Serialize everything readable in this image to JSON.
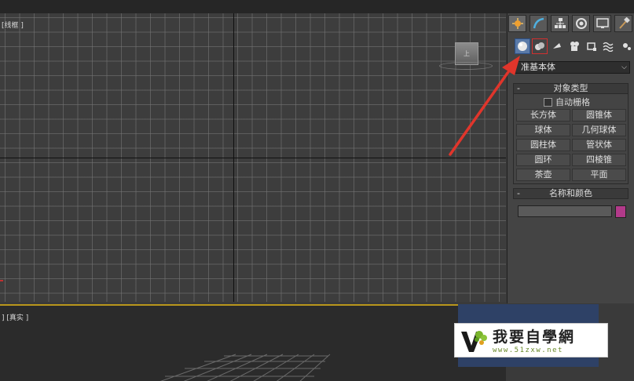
{
  "viewports": {
    "top": {
      "label": "[线框 ]",
      "viewcube_label": "上"
    },
    "perspective": {
      "label": "] [真实 ]"
    }
  },
  "command_panel": {
    "tabs": [
      {
        "name": "create",
        "icon": "star-icon"
      },
      {
        "name": "modify",
        "icon": "curve-icon"
      },
      {
        "name": "hierarchy",
        "icon": "hierarchy-icon"
      },
      {
        "name": "motion",
        "icon": "motion-icon"
      },
      {
        "name": "display",
        "icon": "monitor-icon"
      },
      {
        "name": "utilities",
        "icon": "hammer-icon"
      }
    ],
    "subtabs": [
      {
        "name": "geometry",
        "icon": "sphere-icon"
      },
      {
        "name": "shapes",
        "icon": "shapes-icon"
      },
      {
        "name": "lights",
        "icon": "light-icon"
      },
      {
        "name": "cameras",
        "icon": "camera-icon"
      },
      {
        "name": "helpers",
        "icon": "helper-icon"
      },
      {
        "name": "space-warps",
        "icon": "wave-icon"
      },
      {
        "name": "systems",
        "icon": "gear-icon"
      }
    ],
    "dropdown_value": "准基本体",
    "object_type": {
      "title": "对象类型",
      "collapse": "-",
      "autogrid_label": "自动栅格",
      "buttons": [
        "长方体",
        "圆锥体",
        "球体",
        "几何球体",
        "圆柱体",
        "管状体",
        "圆环",
        "四棱锥",
        "茶壶",
        "平面"
      ]
    },
    "name_color": {
      "title": "名称和颜色",
      "collapse": "-",
      "name_value": "",
      "swatch_color": "#b23a8a"
    }
  },
  "watermark": {
    "title": "我要自學網",
    "url": "www.51zxw.net"
  },
  "colors": {
    "annotation_arrow": "#e0352b",
    "viewport_active_border": "#b8961c"
  }
}
